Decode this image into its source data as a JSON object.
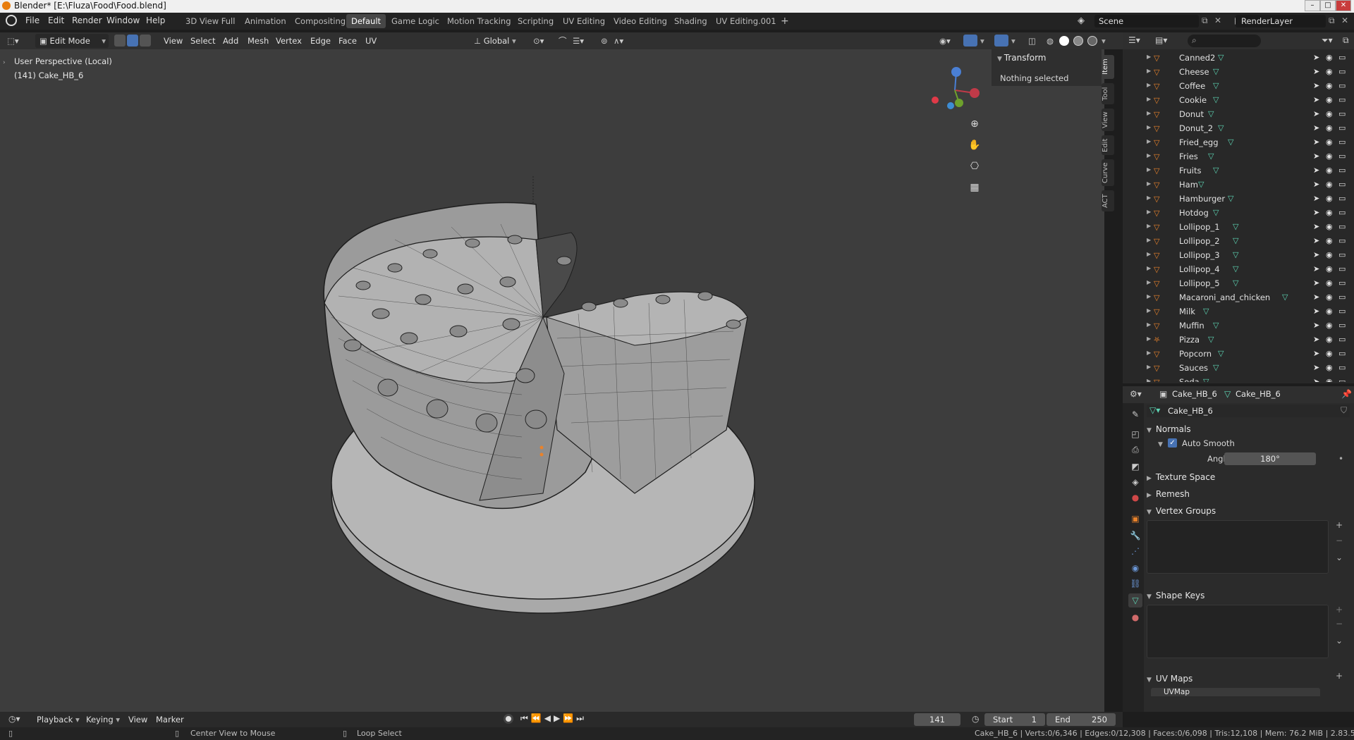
{
  "window": {
    "title": "Blender* [E:\\Fluza\\Food\\Food.blend]"
  },
  "menu": [
    "File",
    "Edit",
    "Render",
    "Window",
    "Help"
  ],
  "workspaces": [
    "3D View Full",
    "Animation",
    "Compositing",
    "Default",
    "Game Logic",
    "Motion Tracking",
    "Scripting",
    "UV Editing",
    "Video Editing",
    "Shading",
    "UV Editing.001"
  ],
  "active_workspace": "Default",
  "scene": {
    "label": "Scene",
    "render_layer": "RenderLayer"
  },
  "viewport_header": {
    "mode": "Edit Mode",
    "menus": [
      "View",
      "Select",
      "Add",
      "Mesh",
      "Vertex",
      "Edge",
      "Face",
      "UV"
    ],
    "orientation": "Global"
  },
  "viewport": {
    "perspective": "User Perspective (Local)",
    "object_info": "(141) Cake_HB_6"
  },
  "npanel": {
    "section": "Transform",
    "message": "Nothing selected",
    "tabs": [
      "Item",
      "Tool",
      "View",
      "Edit",
      "Curve",
      "ACT"
    ]
  },
  "outliner": {
    "items": [
      {
        "name": "Canned2"
      },
      {
        "name": "Cheese"
      },
      {
        "name": "Coffee"
      },
      {
        "name": "Cookie"
      },
      {
        "name": "Donut"
      },
      {
        "name": "Donut_2"
      },
      {
        "name": "Fried_egg"
      },
      {
        "name": "Fries"
      },
      {
        "name": "Fruits"
      },
      {
        "name": "Ham"
      },
      {
        "name": "Hamburger"
      },
      {
        "name": "Hotdog"
      },
      {
        "name": "Lollipop_1"
      },
      {
        "name": "Lollipop_2"
      },
      {
        "name": "Lollipop_3"
      },
      {
        "name": "Lollipop_4"
      },
      {
        "name": "Lollipop_5"
      },
      {
        "name": "Macaroni_and_chicken"
      },
      {
        "name": "Milk"
      },
      {
        "name": "Muffin"
      },
      {
        "name": "Pizza"
      },
      {
        "name": "Popcorn"
      },
      {
        "name": "Sauces"
      },
      {
        "name": "Soda"
      }
    ]
  },
  "properties": {
    "object_name": "Cake_HB_6",
    "mesh_name": "Cake_HB_6",
    "data_name": "Cake_HB_6",
    "normals_label": "Normals",
    "auto_smooth_label": "Auto Smooth",
    "angle_label": "Angle",
    "angle_value": "180°",
    "sections": [
      "Texture Space",
      "Remesh",
      "Vertex Groups",
      "Shape Keys",
      "UV Maps"
    ],
    "uvmap": "UVMap"
  },
  "timeline": {
    "menus": [
      "Playback",
      "Keying",
      "View",
      "Marker"
    ],
    "current_frame": "141",
    "start_label": "Start",
    "start": "1",
    "end_label": "End",
    "end": "250"
  },
  "statusbar": {
    "hint1": "Center View to Mouse",
    "hint2": "Loop Select",
    "stats": "Cake_HB_6 | Verts:0/6,346 | Edges:0/12,308 | Faces:0/6,098 | Tris:12,108 | Mem: 76.2 MiB | 2.83.5"
  }
}
